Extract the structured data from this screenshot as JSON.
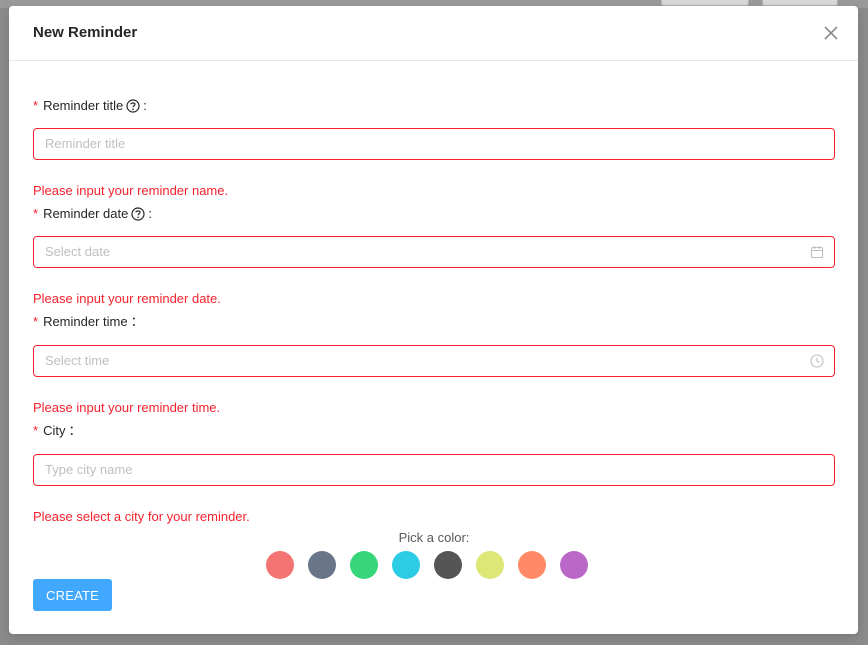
{
  "modal": {
    "title": "New Reminder",
    "close_icon": "close-icon"
  },
  "form": {
    "title_field": {
      "label": "Reminder title",
      "required_mark": "*",
      "help_icon": "question-circle-icon",
      "colon": ":",
      "placeholder": "Reminder title",
      "value": "",
      "error": "Please input your reminder name."
    },
    "date_field": {
      "label": "Reminder date",
      "required_mark": "*",
      "help_icon": "question-circle-icon",
      "colon": ":",
      "placeholder": "Select date",
      "value": "",
      "suffix_icon": "calendar-icon",
      "error": "Please input your reminder date."
    },
    "time_field": {
      "label": "Reminder time",
      "required_mark": "*",
      "colon": "：",
      "placeholder": "Select time",
      "value": "",
      "suffix_icon": "clock-icon",
      "error": "Please input your reminder time."
    },
    "city_field": {
      "label": "City",
      "required_mark": "*",
      "colon": "：",
      "placeholder": "Type city name",
      "value": "",
      "error": "Please select a city for your reminder."
    },
    "color_picker": {
      "label": "Pick a color:",
      "colors": [
        "#f47373",
        "#697689",
        "#37d67a",
        "#2ccce4",
        "#555555",
        "#dce775",
        "#ff8a65",
        "#ba68c8"
      ]
    }
  },
  "footer": {
    "create_label": "CREATE"
  },
  "theme": {
    "error_color": "#f5222d",
    "primary_color": "#40a9ff"
  }
}
